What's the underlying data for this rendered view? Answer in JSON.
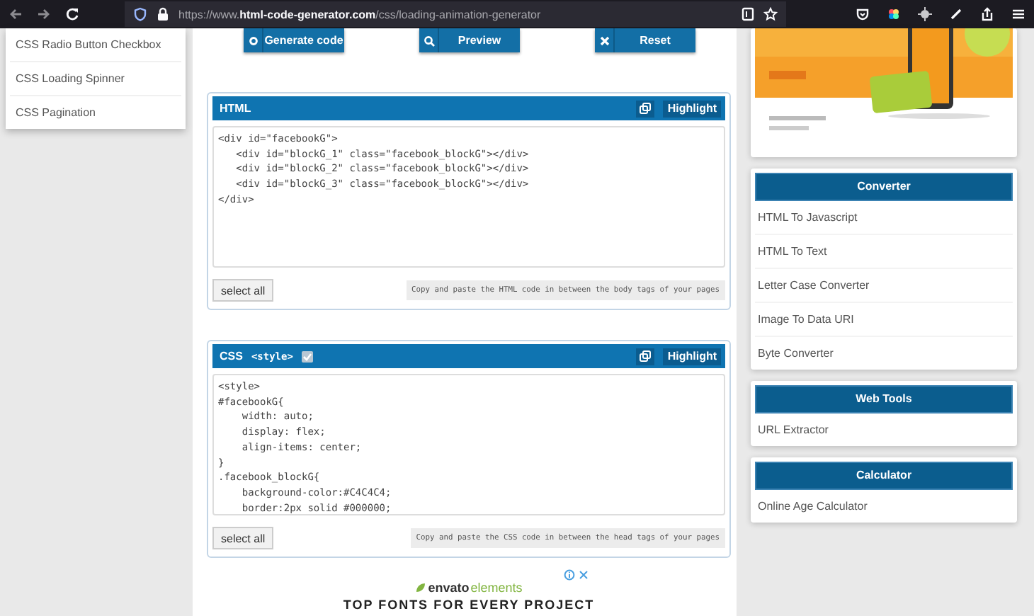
{
  "browser": {
    "url_prefix": "https://www.",
    "url_domain": "html-code-generator.com",
    "url_path": "/css/loading-animation-generator"
  },
  "menu": {
    "items": [
      {
        "label": "CSS Radio Button Checkbox"
      },
      {
        "label": "CSS Loading Spinner"
      },
      {
        "label": "CSS Pagination"
      }
    ]
  },
  "actions": [
    {
      "label": "Generate code",
      "kind": "gear"
    },
    {
      "label": "Preview",
      "kind": "search"
    },
    {
      "label": "Reset",
      "kind": "close"
    }
  ],
  "panels": [
    {
      "title": "HTML",
      "code": "<div id=\"facebookG\">\n   <div id=\"blockG_1\" class=\"facebook_blockG\"></div>\n   <div id=\"blockG_2\" class=\"facebook_blockG\"></div>\n   <div id=\"blockG_3\" class=\"facebook_blockG\"></div>\n</div>",
      "highlight": "Highlight",
      "select_all": "select all",
      "note": "Copy and paste the HTML code in between the body tags of your pages"
    },
    {
      "title": "CSS",
      "tag_label": "<style>",
      "tag_checked": true,
      "code": "<style>\n#facebookG{\n    width: auto;\n    display: flex;\n    align-items: center;\n}\n.facebook_blockG{\n    background-color:#C4C4C4;\n    border:2px solid #000000;",
      "highlight": "Highlight",
      "select_all": "select all",
      "note": "Copy and paste the CSS code in between the head tags of your pages"
    }
  ],
  "ad": {
    "brand": "envato",
    "brand_suffix": "elements",
    "headline": "TOP FONTS FOR EVERY PROJECT"
  },
  "sidebar": [
    {
      "kind": "picture"
    },
    {
      "kind": "links",
      "title": "Converter",
      "items": [
        "HTML To Javascript",
        "HTML To Text",
        "Letter Case Converter",
        "Image To Data URI",
        "Byte Converter"
      ]
    },
    {
      "kind": "links",
      "title": "Web Tools",
      "items": [
        "URL Extractor"
      ]
    },
    {
      "kind": "links",
      "title": "Calculator",
      "items": [
        "Online Age Calculator"
      ]
    }
  ]
}
